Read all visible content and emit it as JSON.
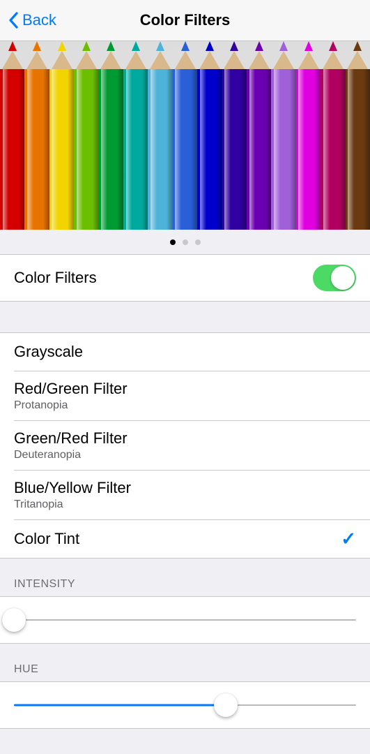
{
  "nav": {
    "back_label": "Back",
    "title": "Color Filters"
  },
  "preview": {
    "pencil_colors": [
      "#d40000",
      "#e87400",
      "#f2d400",
      "#6bbf00",
      "#009a32",
      "#00a99d",
      "#4fb2d8",
      "#2a5fd8",
      "#0000cc",
      "#3000a0",
      "#6b00b0",
      "#a060d8",
      "#e000e0",
      "#b00060",
      "#6b3a12"
    ],
    "page_index": 0,
    "page_count": 3
  },
  "toggle_row": {
    "label": "Color Filters",
    "enabled": true
  },
  "filters": [
    {
      "title": "Grayscale",
      "subtitle": "",
      "selected": false
    },
    {
      "title": "Red/Green Filter",
      "subtitle": "Protanopia",
      "selected": false
    },
    {
      "title": "Green/Red Filter",
      "subtitle": "Deuteranopia",
      "selected": false
    },
    {
      "title": "Blue/Yellow Filter",
      "subtitle": "Tritanopia",
      "selected": false
    },
    {
      "title": "Color Tint",
      "subtitle": "",
      "selected": true
    }
  ],
  "intensity": {
    "header": "INTENSITY",
    "value": 0
  },
  "hue": {
    "header": "HUE",
    "value": 62
  }
}
